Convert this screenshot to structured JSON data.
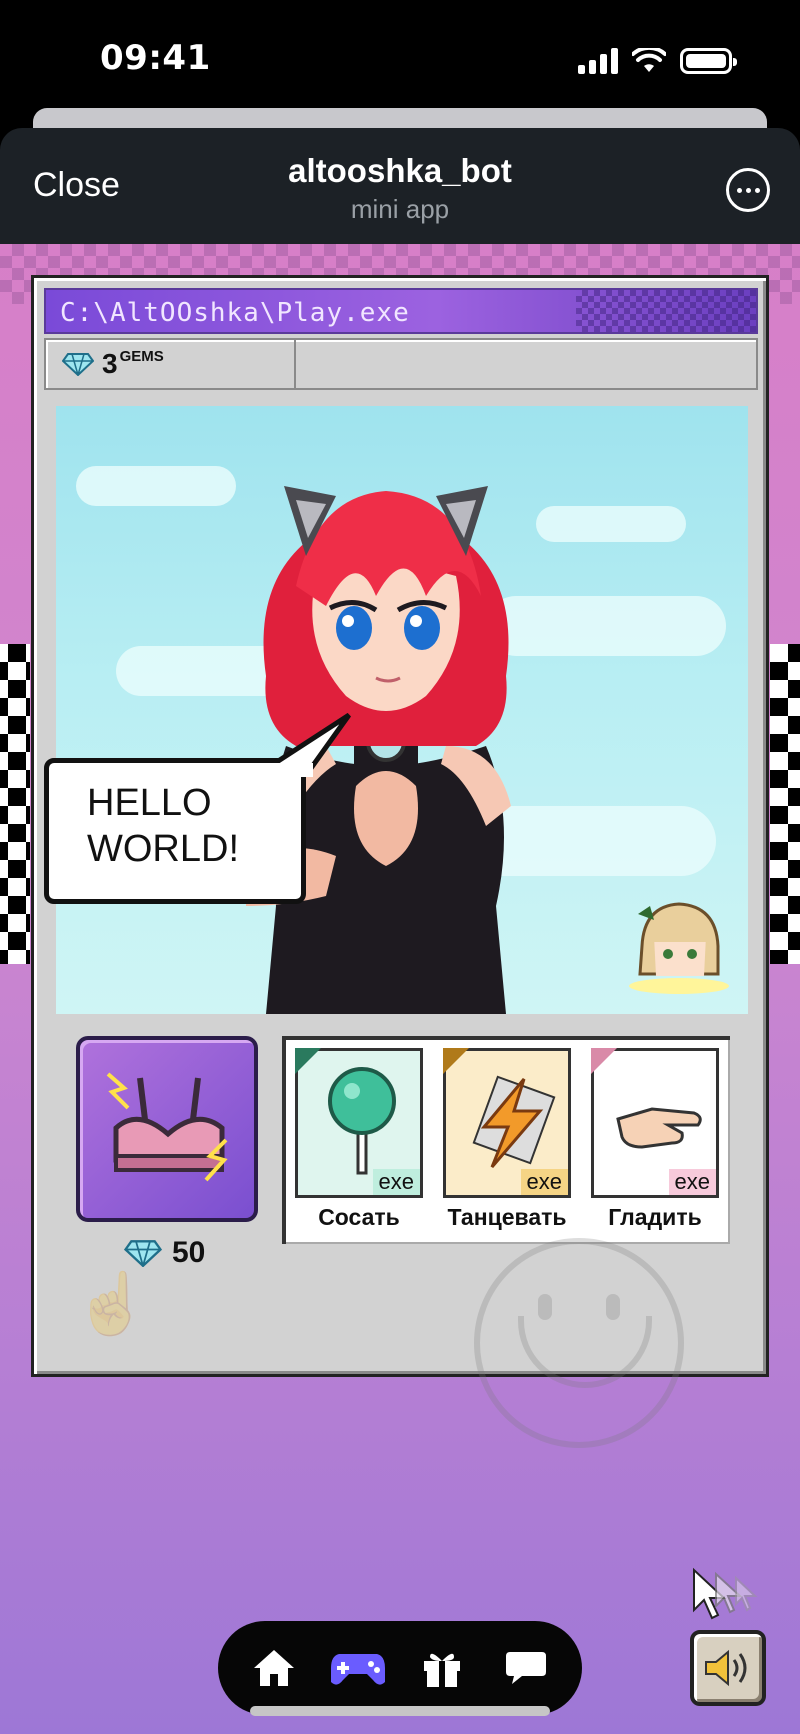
{
  "status_bar": {
    "time": "09:41"
  },
  "header": {
    "close_label": "Close",
    "title": "altooshka_bot",
    "subtitle": "mini app"
  },
  "window": {
    "title": "C:\\AltOOshka\\Play.exe",
    "gems_value": "3",
    "gems_unit": "GEMS"
  },
  "scene": {
    "speech": "HELLO\nWORLD!"
  },
  "shop_item": {
    "icon": "bra-icon",
    "price": "50"
  },
  "actions": [
    {
      "label": "Сосать",
      "tag": "exe",
      "icon": "lollipop-icon",
      "color": "#3fae8a",
      "bg": "#dff5ee"
    },
    {
      "label": "Танцевать",
      "tag": "exe",
      "icon": "lightning-icon",
      "color": "#e8a63a",
      "bg": "#fbecc9"
    },
    {
      "label": "Гладить",
      "tag": "exe",
      "icon": "hand-icon",
      "color": "#e6a7c0",
      "bg": "#fbe2ec"
    }
  ],
  "nav": {
    "items": [
      {
        "icon": "home-icon"
      },
      {
        "icon": "gamepad-icon",
        "active": true
      },
      {
        "icon": "gift-icon"
      },
      {
        "icon": "chat-icon"
      }
    ]
  },
  "colors": {
    "accent": "#7a4ad8",
    "header_bg": "#1c2126",
    "nav_active": "#6a5cff"
  }
}
